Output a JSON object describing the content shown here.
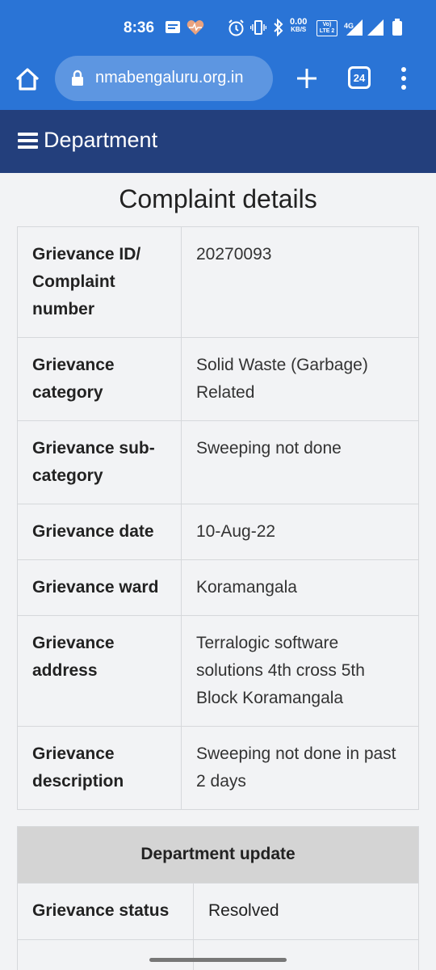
{
  "status_bar": {
    "time": "8:36",
    "net_speed_value": "0.00",
    "net_speed_unit": "KB/S",
    "volte_top": "Vo)",
    "volte_bottom": "LTE 2",
    "network_type": "4G",
    "icons": [
      "message-icon",
      "heart-rate-icon",
      "alarm-icon",
      "vibrate-icon",
      "bluetooth-icon",
      "signal-icon",
      "battery-icon"
    ]
  },
  "browser": {
    "url": "nmabengaluru.org.in",
    "tab_count": "24",
    "colors": {
      "toolbar": "#2a74d6",
      "urlbox": "#5d96e1"
    }
  },
  "header": {
    "title": "Department",
    "color": "#233f7c"
  },
  "page_title": "Complaint details",
  "details": [
    {
      "key": "Grievance ID/ Complaint number",
      "value": "20270093"
    },
    {
      "key": "Grievance category",
      "value": "Solid Waste (Garbage) Related"
    },
    {
      "key": "Grievance sub-category",
      "value": "Sweeping not done"
    },
    {
      "key": "Grievance date",
      "value": "10-Aug-22"
    },
    {
      "key": "Grievance ward",
      "value": "Koramangala"
    },
    {
      "key": "Grievance address",
      "value": "Terralogic software solutions 4th cross 5th Block Koramangala"
    },
    {
      "key": "Grievance description",
      "value": "Sweeping not done in past 2 days"
    }
  ],
  "department_update": {
    "heading": "Department update",
    "rows": [
      {
        "key": "Grievance status",
        "value": "Resolved"
      },
      {
        "key": "",
        "value": ""
      }
    ]
  }
}
